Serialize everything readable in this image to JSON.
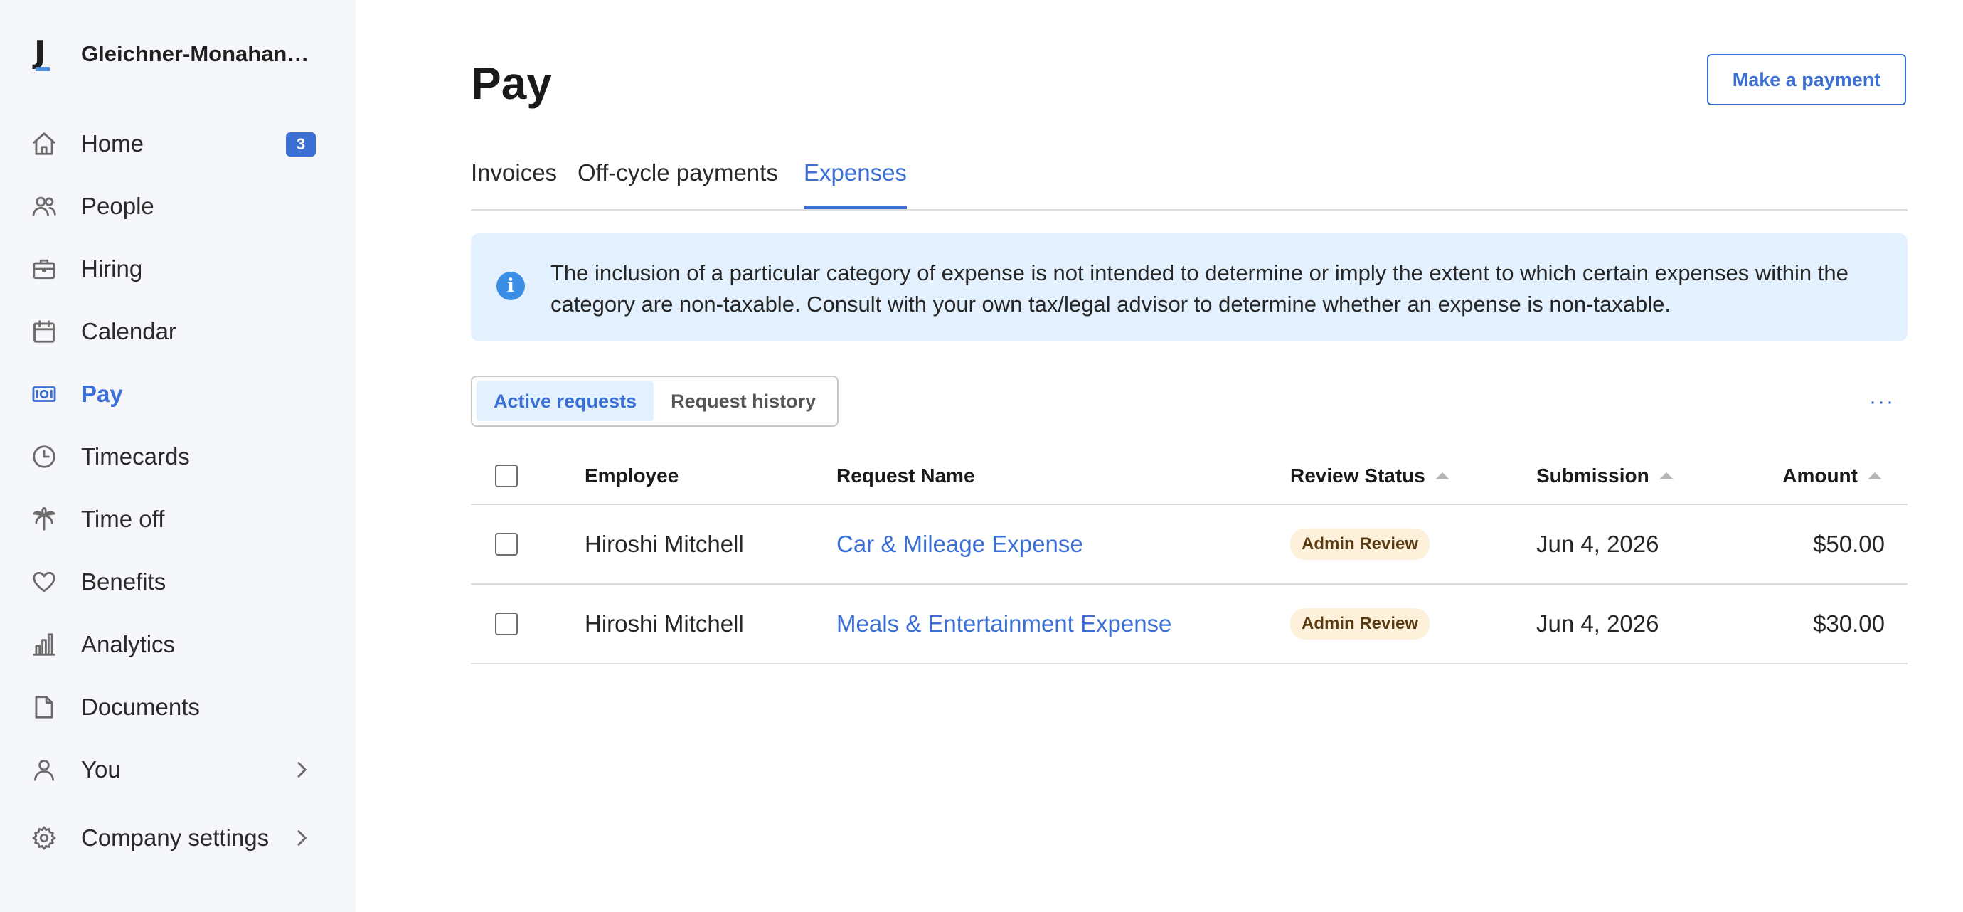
{
  "sidebar": {
    "company_name": "Gleichner-Monahan…",
    "logo_letter": "J",
    "items": [
      {
        "label": "Home",
        "icon": "home-icon",
        "badge": "3"
      },
      {
        "label": "People",
        "icon": "people-icon"
      },
      {
        "label": "Hiring",
        "icon": "briefcase-icon"
      },
      {
        "label": "Calendar",
        "icon": "calendar-icon"
      },
      {
        "label": "Pay",
        "icon": "money-icon",
        "active": true
      },
      {
        "label": "Timecards",
        "icon": "clock-icon"
      },
      {
        "label": "Time off",
        "icon": "palm-tree-icon"
      },
      {
        "label": "Benefits",
        "icon": "heart-icon"
      },
      {
        "label": "Analytics",
        "icon": "bar-chart-icon"
      },
      {
        "label": "Documents",
        "icon": "document-icon"
      },
      {
        "label": "You",
        "icon": "user-icon",
        "chevron": true
      },
      {
        "label": "Company settings",
        "icon": "gear-icon",
        "chevron": true
      }
    ]
  },
  "header": {
    "title": "Pay",
    "primary_button": "Make a payment"
  },
  "tabs": [
    {
      "label": "Invoices"
    },
    {
      "label": "Off-cycle payments"
    },
    {
      "label": "Expenses",
      "active": true
    }
  ],
  "notice": {
    "icon": "info-icon",
    "text": "The inclusion of a particular category of expense is not intended to determine or imply the extent to which certain expenses within the category are non-taxable. Consult with your own tax/legal advisor to determine whether an expense is non-taxable."
  },
  "segmented": {
    "options": [
      "Active requests",
      "Request history"
    ],
    "selected": "Active requests"
  },
  "more_menu": "···",
  "table": {
    "columns": [
      "Employee",
      "Request Name",
      "Review Status",
      "Submission",
      "Amount"
    ],
    "rows": [
      {
        "employee": "Hiroshi Mitchell",
        "request": "Car & Mileage Expense",
        "status": "Admin Review",
        "submission": "Jun 4, 2026",
        "amount": "$50.00"
      },
      {
        "employee": "Hiroshi Mitchell",
        "request": "Meals & Entertainment Expense",
        "status": "Admin Review",
        "submission": "Jun 4, 2026",
        "amount": "$30.00"
      }
    ]
  },
  "colors": {
    "accent": "#3b6fd4",
    "sidebar_bg": "#f6f7fa",
    "notice_bg": "#e3f0fd",
    "status_badge_bg": "#fdf1dc"
  }
}
